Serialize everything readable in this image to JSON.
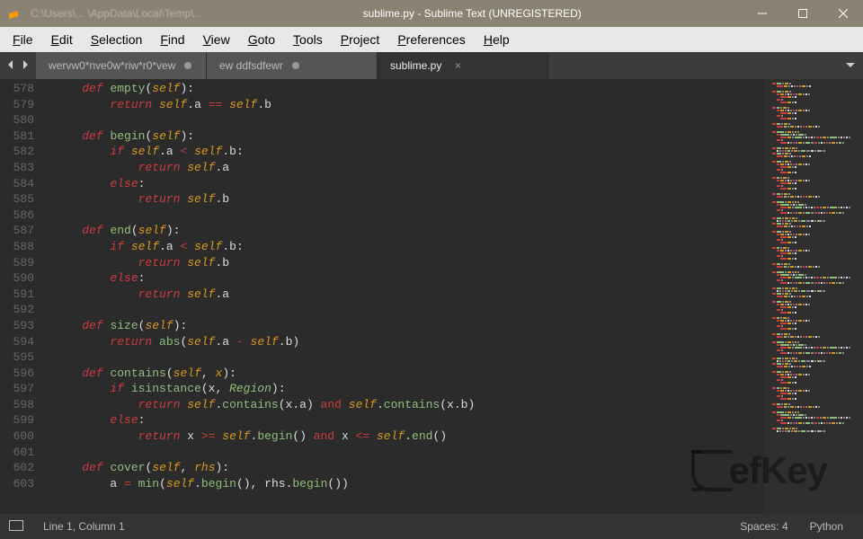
{
  "window": {
    "path_hint": "C:\\Users\\... \\AppData\\Local\\Temp\\...",
    "title": "sublime.py - Sublime Text (UNREGISTERED)"
  },
  "menu": [
    "File",
    "Edit",
    "Selection",
    "Find",
    "View",
    "Goto",
    "Tools",
    "Project",
    "Preferences",
    "Help"
  ],
  "tabs": [
    {
      "label": "wervw0*nve0w*riw*r0*vew",
      "dirty": true,
      "active": false
    },
    {
      "label": "ew ddfsdfewr",
      "dirty": true,
      "active": false
    },
    {
      "label": "sublime.py",
      "dirty": false,
      "active": true
    }
  ],
  "editor": {
    "first_line": 578,
    "lines": [
      [
        [
          "kw",
          "def "
        ],
        [
          "fn",
          "empty"
        ],
        [
          "pun",
          "("
        ],
        [
          "self",
          "self"
        ],
        [
          "pun",
          "):"
        ]
      ],
      [
        [
          "sp",
          "    "
        ],
        [
          "kw",
          "return "
        ],
        [
          "self",
          "self"
        ],
        [
          "pun",
          "."
        ],
        [
          "id",
          "a"
        ],
        [
          "pun",
          " "
        ],
        [
          "op",
          "=="
        ],
        [
          "pun",
          " "
        ],
        [
          "self",
          "self"
        ],
        [
          "pun",
          "."
        ],
        [
          "id",
          "b"
        ]
      ],
      [],
      [
        [
          "kw",
          "def "
        ],
        [
          "fn",
          "begin"
        ],
        [
          "pun",
          "("
        ],
        [
          "self",
          "self"
        ],
        [
          "pun",
          "):"
        ]
      ],
      [
        [
          "sp",
          "    "
        ],
        [
          "kw",
          "if "
        ],
        [
          "self",
          "self"
        ],
        [
          "pun",
          "."
        ],
        [
          "id",
          "a"
        ],
        [
          "pun",
          " "
        ],
        [
          "op",
          "<"
        ],
        [
          "pun",
          " "
        ],
        [
          "self",
          "self"
        ],
        [
          "pun",
          "."
        ],
        [
          "id",
          "b"
        ],
        [
          "pun",
          ":"
        ]
      ],
      [
        [
          "sp",
          "        "
        ],
        [
          "kw",
          "return "
        ],
        [
          "self",
          "self"
        ],
        [
          "pun",
          "."
        ],
        [
          "id",
          "a"
        ]
      ],
      [
        [
          "sp",
          "    "
        ],
        [
          "kw",
          "else"
        ],
        [
          "pun",
          ":"
        ]
      ],
      [
        [
          "sp",
          "        "
        ],
        [
          "kw",
          "return "
        ],
        [
          "self",
          "self"
        ],
        [
          "pun",
          "."
        ],
        [
          "id",
          "b"
        ]
      ],
      [],
      [
        [
          "kw",
          "def "
        ],
        [
          "fn",
          "end"
        ],
        [
          "pun",
          "("
        ],
        [
          "self",
          "self"
        ],
        [
          "pun",
          "):"
        ]
      ],
      [
        [
          "sp",
          "    "
        ],
        [
          "kw",
          "if "
        ],
        [
          "self",
          "self"
        ],
        [
          "pun",
          "."
        ],
        [
          "id",
          "a"
        ],
        [
          "pun",
          " "
        ],
        [
          "op",
          "<"
        ],
        [
          "pun",
          " "
        ],
        [
          "self",
          "self"
        ],
        [
          "pun",
          "."
        ],
        [
          "id",
          "b"
        ],
        [
          "pun",
          ":"
        ]
      ],
      [
        [
          "sp",
          "        "
        ],
        [
          "kw",
          "return "
        ],
        [
          "self",
          "self"
        ],
        [
          "pun",
          "."
        ],
        [
          "id",
          "b"
        ]
      ],
      [
        [
          "sp",
          "    "
        ],
        [
          "kw",
          "else"
        ],
        [
          "pun",
          ":"
        ]
      ],
      [
        [
          "sp",
          "        "
        ],
        [
          "kw",
          "return "
        ],
        [
          "self",
          "self"
        ],
        [
          "pun",
          "."
        ],
        [
          "id",
          "a"
        ]
      ],
      [],
      [
        [
          "kw",
          "def "
        ],
        [
          "fn",
          "size"
        ],
        [
          "pun",
          "("
        ],
        [
          "self",
          "self"
        ],
        [
          "pun",
          "):"
        ]
      ],
      [
        [
          "sp",
          "    "
        ],
        [
          "kw",
          "return "
        ],
        [
          "fn",
          "abs"
        ],
        [
          "pun",
          "("
        ],
        [
          "self",
          "self"
        ],
        [
          "pun",
          "."
        ],
        [
          "id",
          "a"
        ],
        [
          "pun",
          " "
        ],
        [
          "op",
          "-"
        ],
        [
          "pun",
          " "
        ],
        [
          "self",
          "self"
        ],
        [
          "pun",
          "."
        ],
        [
          "id",
          "b"
        ],
        [
          "pun",
          ")"
        ]
      ],
      [],
      [
        [
          "kw",
          "def "
        ],
        [
          "fn",
          "contains"
        ],
        [
          "pun",
          "("
        ],
        [
          "self",
          "self"
        ],
        [
          "pun",
          ", "
        ],
        [
          "param",
          "x"
        ],
        [
          "pun",
          "):"
        ]
      ],
      [
        [
          "sp",
          "    "
        ],
        [
          "kw",
          "if "
        ],
        [
          "fn",
          "isinstance"
        ],
        [
          "pun",
          "("
        ],
        [
          "id",
          "x"
        ],
        [
          "pun",
          ", "
        ],
        [
          "cls",
          "Region"
        ],
        [
          "pun",
          "):"
        ]
      ],
      [
        [
          "sp",
          "        "
        ],
        [
          "kw",
          "return "
        ],
        [
          "self",
          "self"
        ],
        [
          "pun",
          "."
        ],
        [
          "fn",
          "contains"
        ],
        [
          "pun",
          "("
        ],
        [
          "id",
          "x"
        ],
        [
          "pun",
          "."
        ],
        [
          "id",
          "a"
        ],
        [
          "pun",
          ") "
        ],
        [
          "op",
          "and"
        ],
        [
          "pun",
          " "
        ],
        [
          "self",
          "self"
        ],
        [
          "pun",
          "."
        ],
        [
          "fn",
          "contains"
        ],
        [
          "pun",
          "("
        ],
        [
          "id",
          "x"
        ],
        [
          "pun",
          "."
        ],
        [
          "id",
          "b"
        ],
        [
          "pun",
          ")"
        ]
      ],
      [
        [
          "sp",
          "    "
        ],
        [
          "kw",
          "else"
        ],
        [
          "pun",
          ":"
        ]
      ],
      [
        [
          "sp",
          "        "
        ],
        [
          "kw",
          "return "
        ],
        [
          "id",
          "x"
        ],
        [
          "pun",
          " "
        ],
        [
          "op",
          ">="
        ],
        [
          "pun",
          " "
        ],
        [
          "self",
          "self"
        ],
        [
          "pun",
          "."
        ],
        [
          "fn",
          "begin"
        ],
        [
          "pun",
          "() "
        ],
        [
          "op",
          "and"
        ],
        [
          "pun",
          " "
        ],
        [
          "id",
          "x"
        ],
        [
          "pun",
          " "
        ],
        [
          "op",
          "<="
        ],
        [
          "pun",
          " "
        ],
        [
          "self",
          "self"
        ],
        [
          "pun",
          "."
        ],
        [
          "fn",
          "end"
        ],
        [
          "pun",
          "()"
        ]
      ],
      [],
      [
        [
          "kw",
          "def "
        ],
        [
          "fn",
          "cover"
        ],
        [
          "pun",
          "("
        ],
        [
          "self",
          "self"
        ],
        [
          "pun",
          ", "
        ],
        [
          "param",
          "rhs"
        ],
        [
          "pun",
          "):"
        ]
      ],
      [
        [
          "sp",
          "    "
        ],
        [
          "id",
          "a"
        ],
        [
          "pun",
          " "
        ],
        [
          "op",
          "="
        ],
        [
          "pun",
          " "
        ],
        [
          "fn",
          "min"
        ],
        [
          "pun",
          "("
        ],
        [
          "self",
          "self"
        ],
        [
          "pun",
          "."
        ],
        [
          "fn",
          "begin"
        ],
        [
          "pun",
          "(), "
        ],
        [
          "id",
          "rhs"
        ],
        [
          "pun",
          "."
        ],
        [
          "fn",
          "begin"
        ],
        [
          "pun",
          "())"
        ]
      ]
    ],
    "base_indent": "    "
  },
  "status": {
    "position": "Line 1, Column 1",
    "spaces": "Spaces: 4",
    "lang": "Python"
  },
  "colors": {
    "kw": "#cc3d3d",
    "fn": "#8ec07c",
    "self": "#d79921",
    "def": "#d7b35c",
    "cls": "#8ec07c",
    "op": "#cc3d3d",
    "id": "#ddd",
    "pun": "#ddd"
  },
  "watermark": "efKey"
}
